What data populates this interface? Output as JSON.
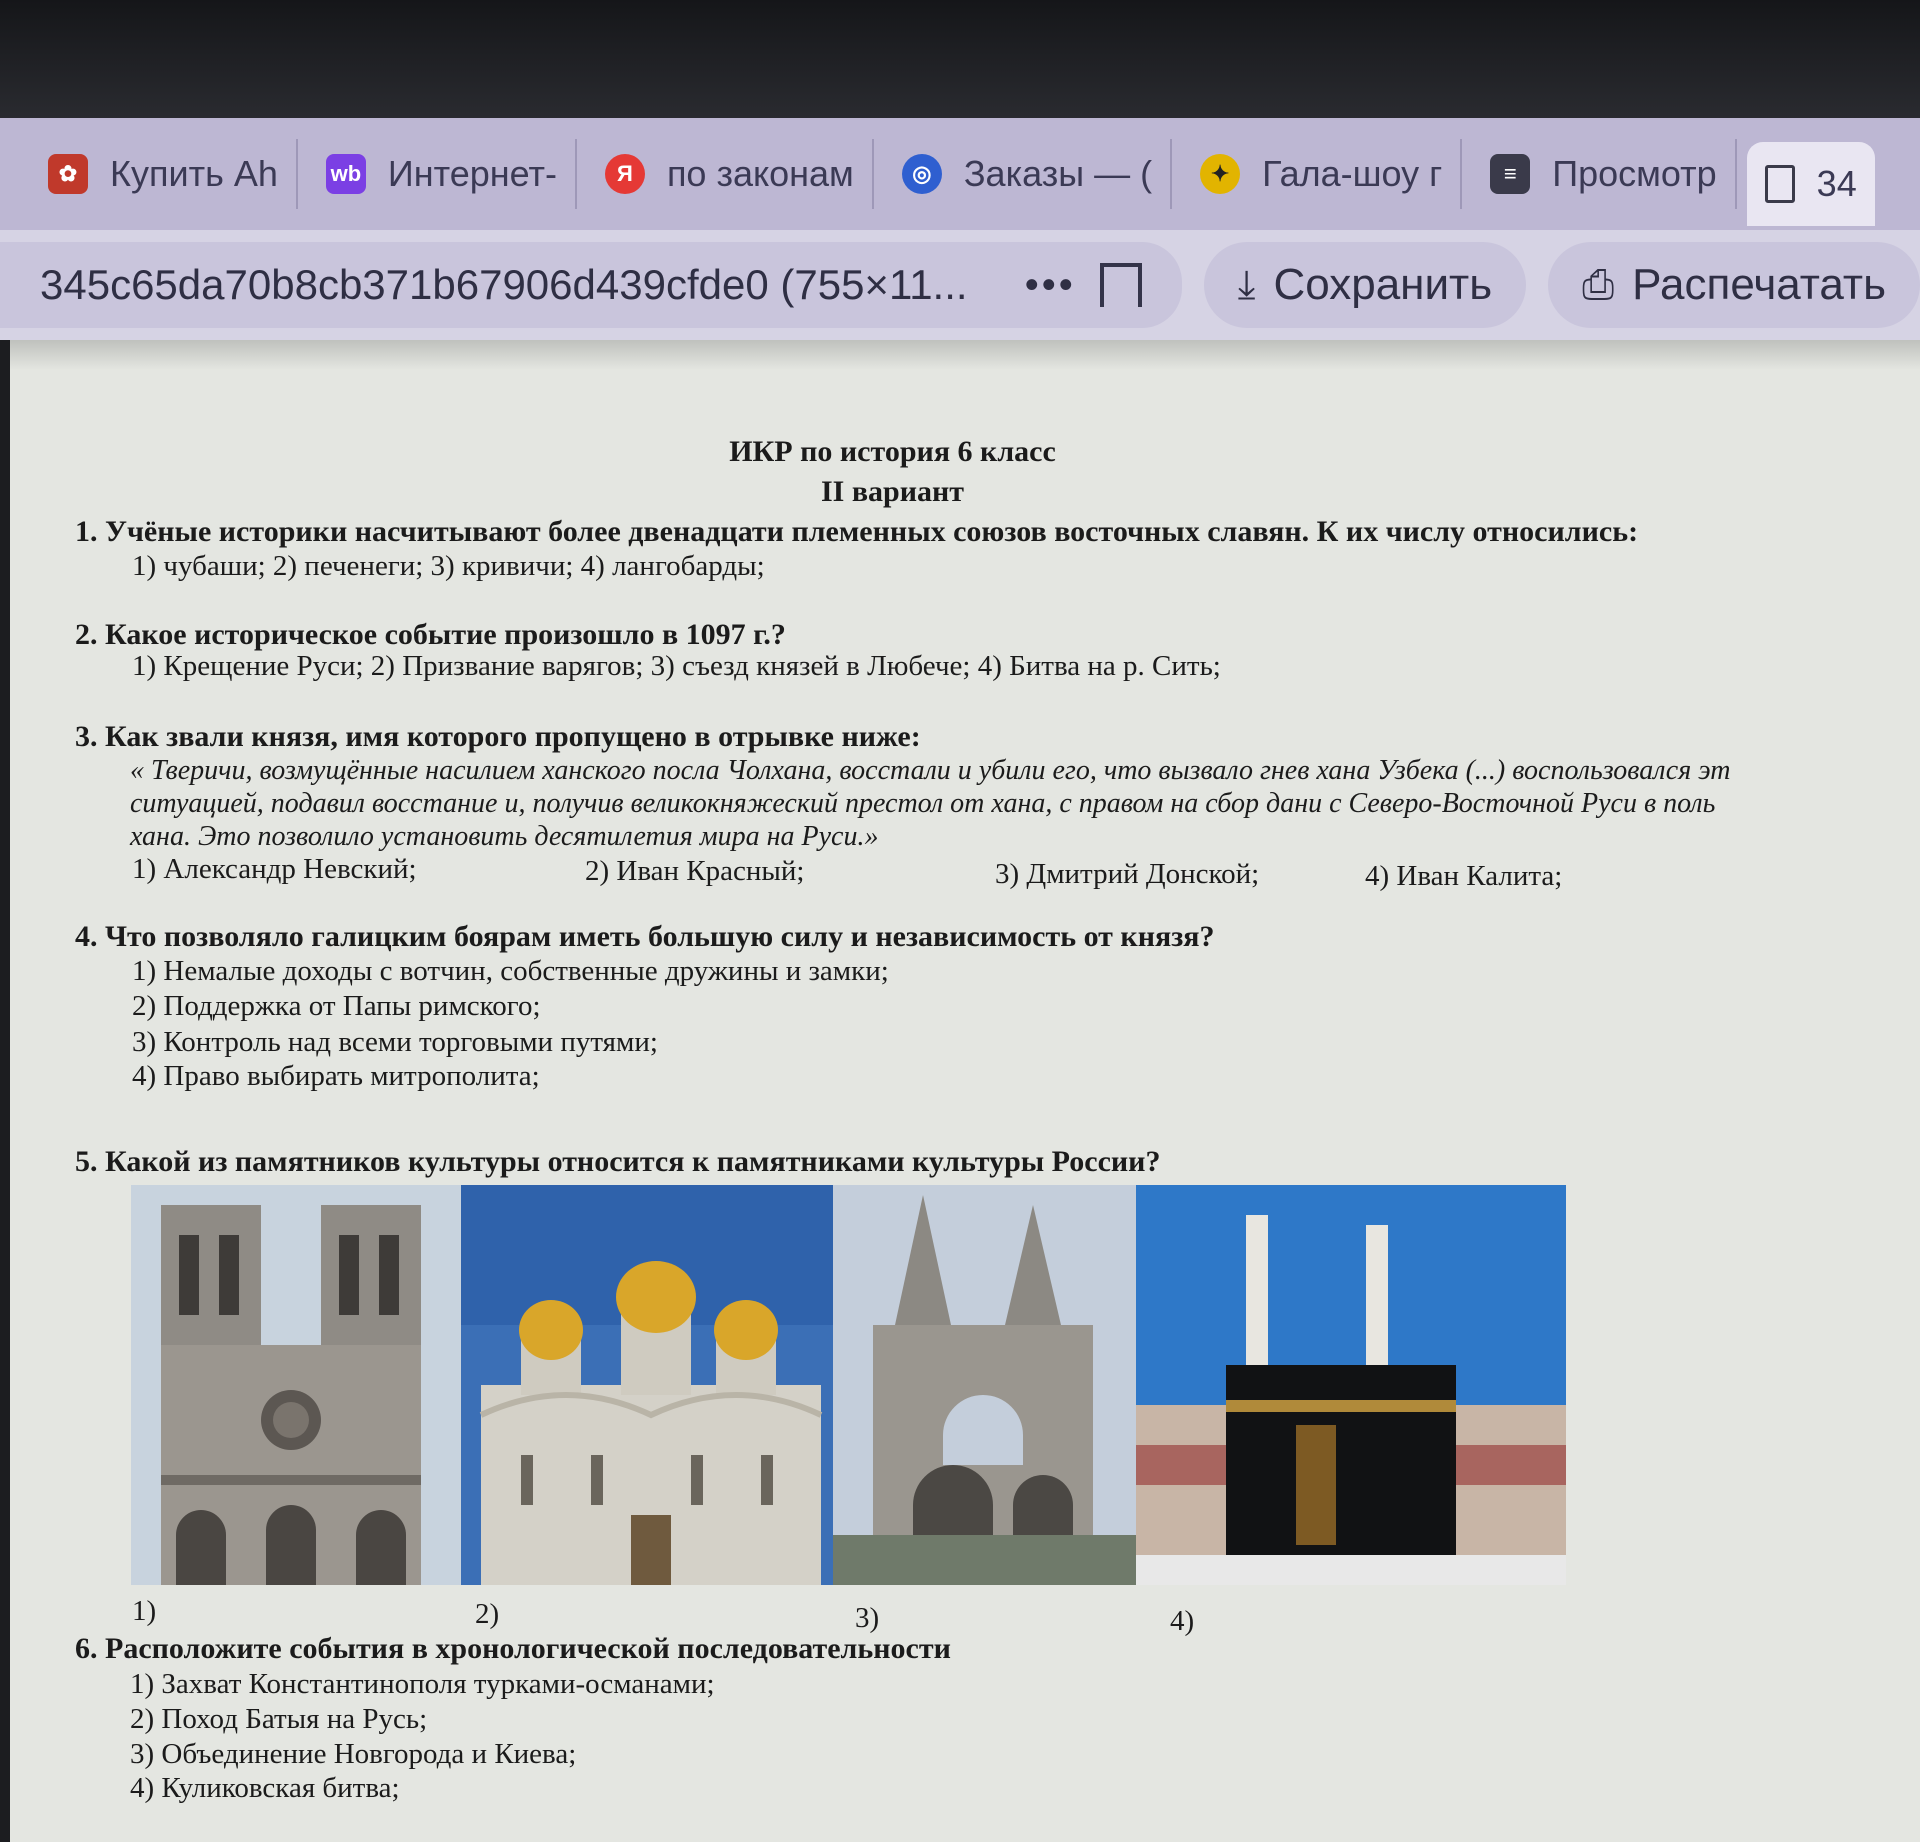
{
  "tabs": [
    {
      "label": "Купить Ah",
      "icon": "flower-icon",
      "color": "#c0392b"
    },
    {
      "label": "Интернет-",
      "icon": "wb-icon",
      "color": "#7b3fe4"
    },
    {
      "label": "по законам",
      "icon": "yandex-icon",
      "color": "#e53935"
    },
    {
      "label": "Заказы — (",
      "icon": "orders-icon",
      "color": "#2f5fd0"
    },
    {
      "label": "Гала-шоу г",
      "icon": "star-icon",
      "color": "#e2b400"
    },
    {
      "label": "Просмотр",
      "icon": "document-icon",
      "color": "#3a3a4a"
    },
    {
      "label": "34",
      "icon": "file-icon",
      "color": "#3a3a4a"
    }
  ],
  "address": {
    "filename": "345c65da70b8cb371b67906d439cfde0 (755×11...",
    "more": "•••"
  },
  "actions": {
    "save": "Сохранить",
    "print": "Распечатать"
  },
  "document": {
    "title1": "ИКР по история 6 класс",
    "title2": "II вариант",
    "q1": {
      "text": "1. Учёные историки насчитывают более двенадцати племенных союзов восточных славян. К их числу относились:",
      "options": "1) чубаши; 2) печенеги; 3) кривичи; 4) лангобарды;"
    },
    "q2": {
      "text": "2. Какое историческое событие произошло в 1097 г.?",
      "options": "1) Крещение Руси;  2) Призвание варягов; 3) съезд князей в Любече; 4) Битва на р. Сить;"
    },
    "q3": {
      "text": "3. Как звали князя, имя которого пропущено в отрывке ниже:",
      "quote1": "« Тверичи, возмущённые насилием ханского посла Чолхана, восстали и убили его, что вызвало гнев хана Узбека  (...) воспользовался эт",
      "quote2": "ситуацией, подавил восстание и, получив великокняжеский престол от хана, с правом на сбор дани с Северо-Восточной Руси в поль",
      "quote3": "хана. Это позволило установить десятилетия мира на Руси.»",
      "o1": "1) Александр Невский;",
      "o2": "2) Иван Красный;",
      "o3": "3) Дмитрий Донской;",
      "o4": "4) Иван Калита;"
    },
    "q4": {
      "text": "4. Что позволяло галицким боярам иметь большую силу и независимость от князя?",
      "o1": "1) Немалые доходы с вотчин, собственные дружины и замки;",
      "o2": "2) Поддержка от Папы римского;",
      "o3": "3) Контроль над всеми торговыми путями;",
      "o4": "4) Право выбирать митрополита;"
    },
    "q5": {
      "text": "5. Какой из памятников культуры относится к памятниками культуры России?",
      "c1": "1)",
      "c2": "2)",
      "c3": "3)",
      "c4": "4)"
    },
    "q6": {
      "text": "6. Расположите события в хронологической последовательности",
      "o1": "1) Захват Константинополя турками-османами;",
      "o2": "2) Поход Батыя на Русь;",
      "o3": "3) Объединение Новгорода и Киева;",
      "o4": "4) Куликовская битва;"
    }
  }
}
